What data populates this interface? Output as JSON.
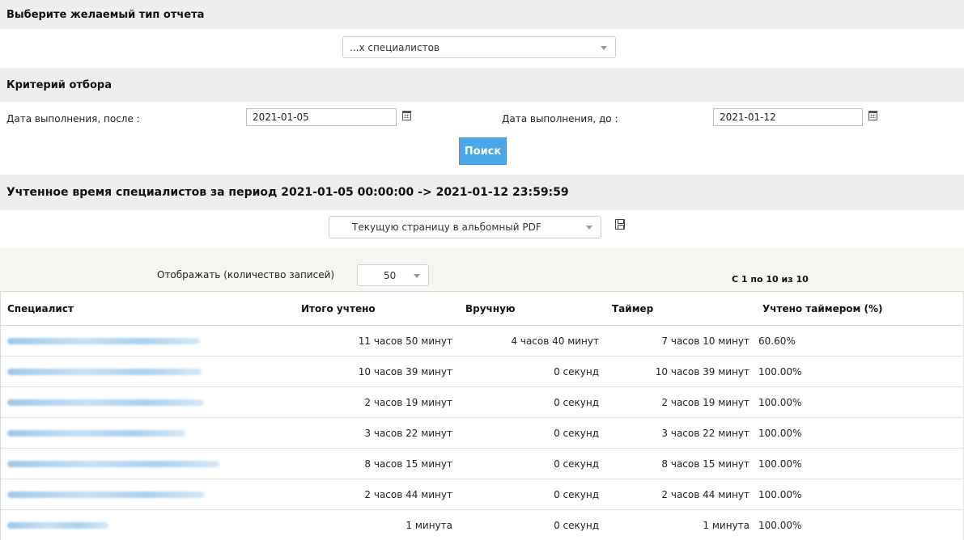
{
  "report_type": {
    "header": "Выберите желаемый тип отчета",
    "selected": "...х специалистов"
  },
  "criteria": {
    "header": "Критерий отбора",
    "date_after_label": "Дата выполнения, после :",
    "date_after_value": "2021-01-05",
    "date_before_label": "Дата выполнения, до :",
    "date_before_value": "2021-01-12",
    "search_label": "Поиск"
  },
  "results": {
    "header": "Учтенное время специалистов за период 2021-01-05 00:00:00 -> 2021-01-12 23:59:59",
    "export_selected": "Текущую страницу в альбомный PDF",
    "page_size_label": "Отображать (количество записей)",
    "page_size_value": "50",
    "pager_text": "С 1 по 10 из 10"
  },
  "table": {
    "columns": [
      "Специалист",
      "Итого учтено",
      "Вручную",
      "Таймер",
      "Учтено таймером (%)"
    ],
    "rows": [
      {
        "total": "11 часов 50 минут",
        "manual": "4 часов 40 минут",
        "timer": "7 часов 10 минут",
        "pct": "60.60%"
      },
      {
        "total": "10 часов 39 минут",
        "manual": "0 секунд",
        "timer": "10 часов 39 минут",
        "pct": "100.00%"
      },
      {
        "total": "2 часов 19 минут",
        "manual": "0 секунд",
        "timer": "2 часов 19 минут",
        "pct": "100.00%"
      },
      {
        "total": "3 часов 22 минут",
        "manual": "0 секунд",
        "timer": "3 часов 22 минут",
        "pct": "100.00%"
      },
      {
        "total": "8 часов 15 минут",
        "manual": "0 секунд",
        "timer": "8 часов 15 минут",
        "pct": "100.00%"
      },
      {
        "total": "2 часов 44 минут",
        "manual": "0 секунд",
        "timer": "2 часов 44 минут",
        "pct": "100.00%"
      },
      {
        "total": "1 минута",
        "manual": "0 секунд",
        "timer": "1 минута",
        "pct": "100.00%"
      }
    ]
  },
  "icons": {
    "calendar": "calendar-icon",
    "save": "save-icon",
    "dropdown": "chevron-down-icon"
  },
  "colors": {
    "search_button": "#4aa8e8",
    "section_header_bg": "#eeeeee",
    "link_blur": "#9cc7ea"
  }
}
